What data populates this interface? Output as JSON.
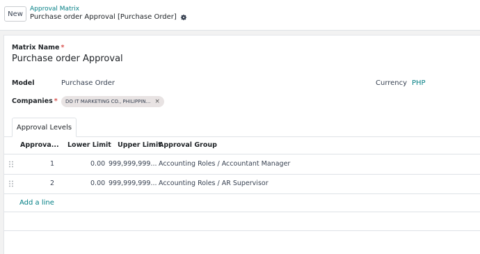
{
  "control_panel": {
    "new_button": "New",
    "breadcrumb_parent": "Approval Matrix",
    "breadcrumb_current": "Purchase order Approval [Purchase Order]"
  },
  "form": {
    "matrix_name_label": "Matrix Name",
    "required_mark": "*",
    "matrix_name_value": "Purchase order Approval",
    "model_label": "Model",
    "model_value": "Purchase Order",
    "currency_label": "Currency",
    "currency_value": "PHP",
    "companies_label": "Companies",
    "company_tag": "DO IT MARKETING CO., PHILIPPIN...",
    "tag_remove": "×"
  },
  "tabs": [
    {
      "label": "Approval Levels",
      "active": true
    }
  ],
  "table": {
    "headers": [
      "Approva...",
      "Lower Limit",
      "Upper Limit",
      "Approval Group"
    ],
    "rows": [
      {
        "level": "1",
        "lower": "0.00",
        "upper": "999,999,999...",
        "group": "Accounting Roles / Accountant Manager"
      },
      {
        "level": "2",
        "lower": "0.00",
        "upper": "999,999,999...",
        "group": "Accounting Roles / AR Supervisor"
      }
    ],
    "add_line": "Add a line"
  },
  "colors": {
    "accent": "#017e84",
    "required": "#d9534f",
    "tag_bg": "#e8e3e3"
  },
  "icons": {
    "settings": "gear-icon",
    "row_handle": "drag-handle-icon",
    "tag_remove": "close-icon"
  }
}
